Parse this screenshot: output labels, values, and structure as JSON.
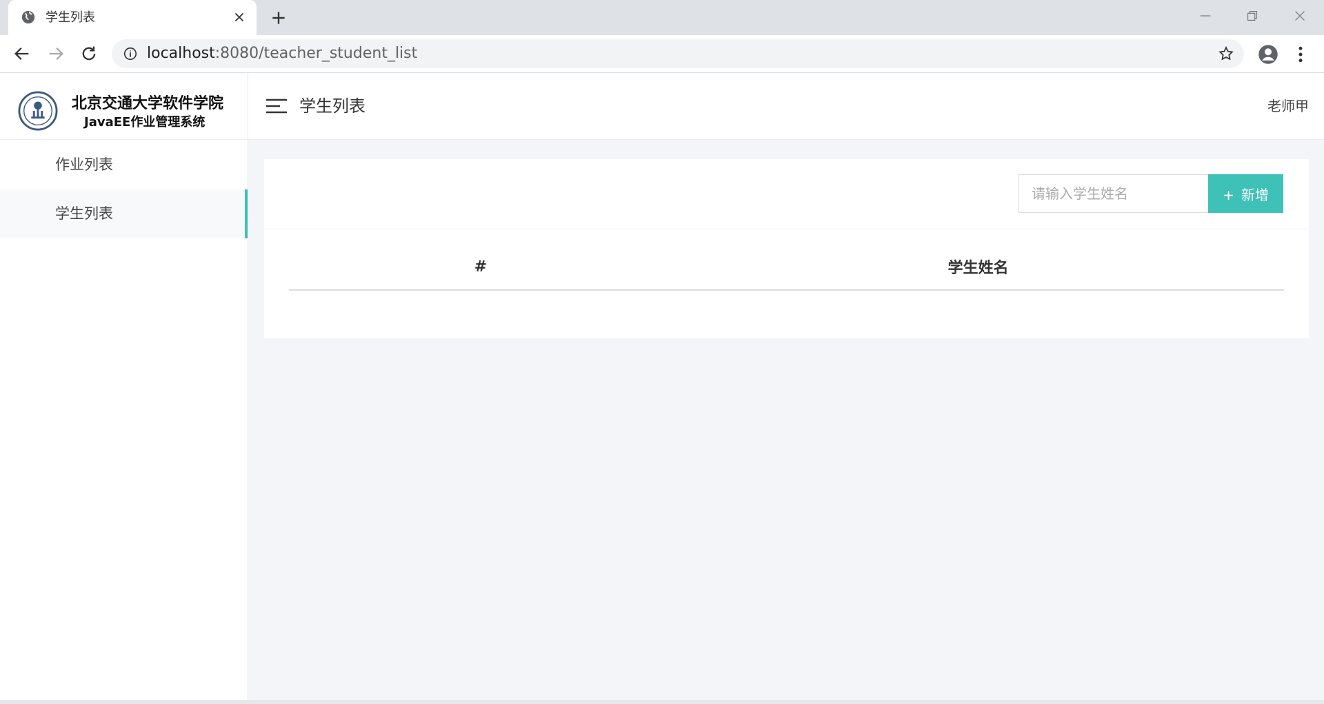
{
  "browser": {
    "tab_title": "学生列表",
    "url_host": "localhost",
    "url_rest": ":8080/teacher_student_list"
  },
  "sidebar": {
    "brand_line1": "北京交通大学软件学院",
    "brand_line2": "JavaEE作业管理系统",
    "items": [
      {
        "label": "作业列表",
        "active": false
      },
      {
        "label": "学生列表",
        "active": true
      }
    ]
  },
  "header": {
    "title": "学生列表",
    "user": "老师甲"
  },
  "main": {
    "search_placeholder": "请输入学生姓名",
    "add_plus": "+",
    "add_label": "新增",
    "table": {
      "columns": [
        "#",
        "学生姓名"
      ],
      "rows": []
    }
  },
  "colors": {
    "accent": "#3ec1b6",
    "page_background": "#f3f5f8"
  }
}
